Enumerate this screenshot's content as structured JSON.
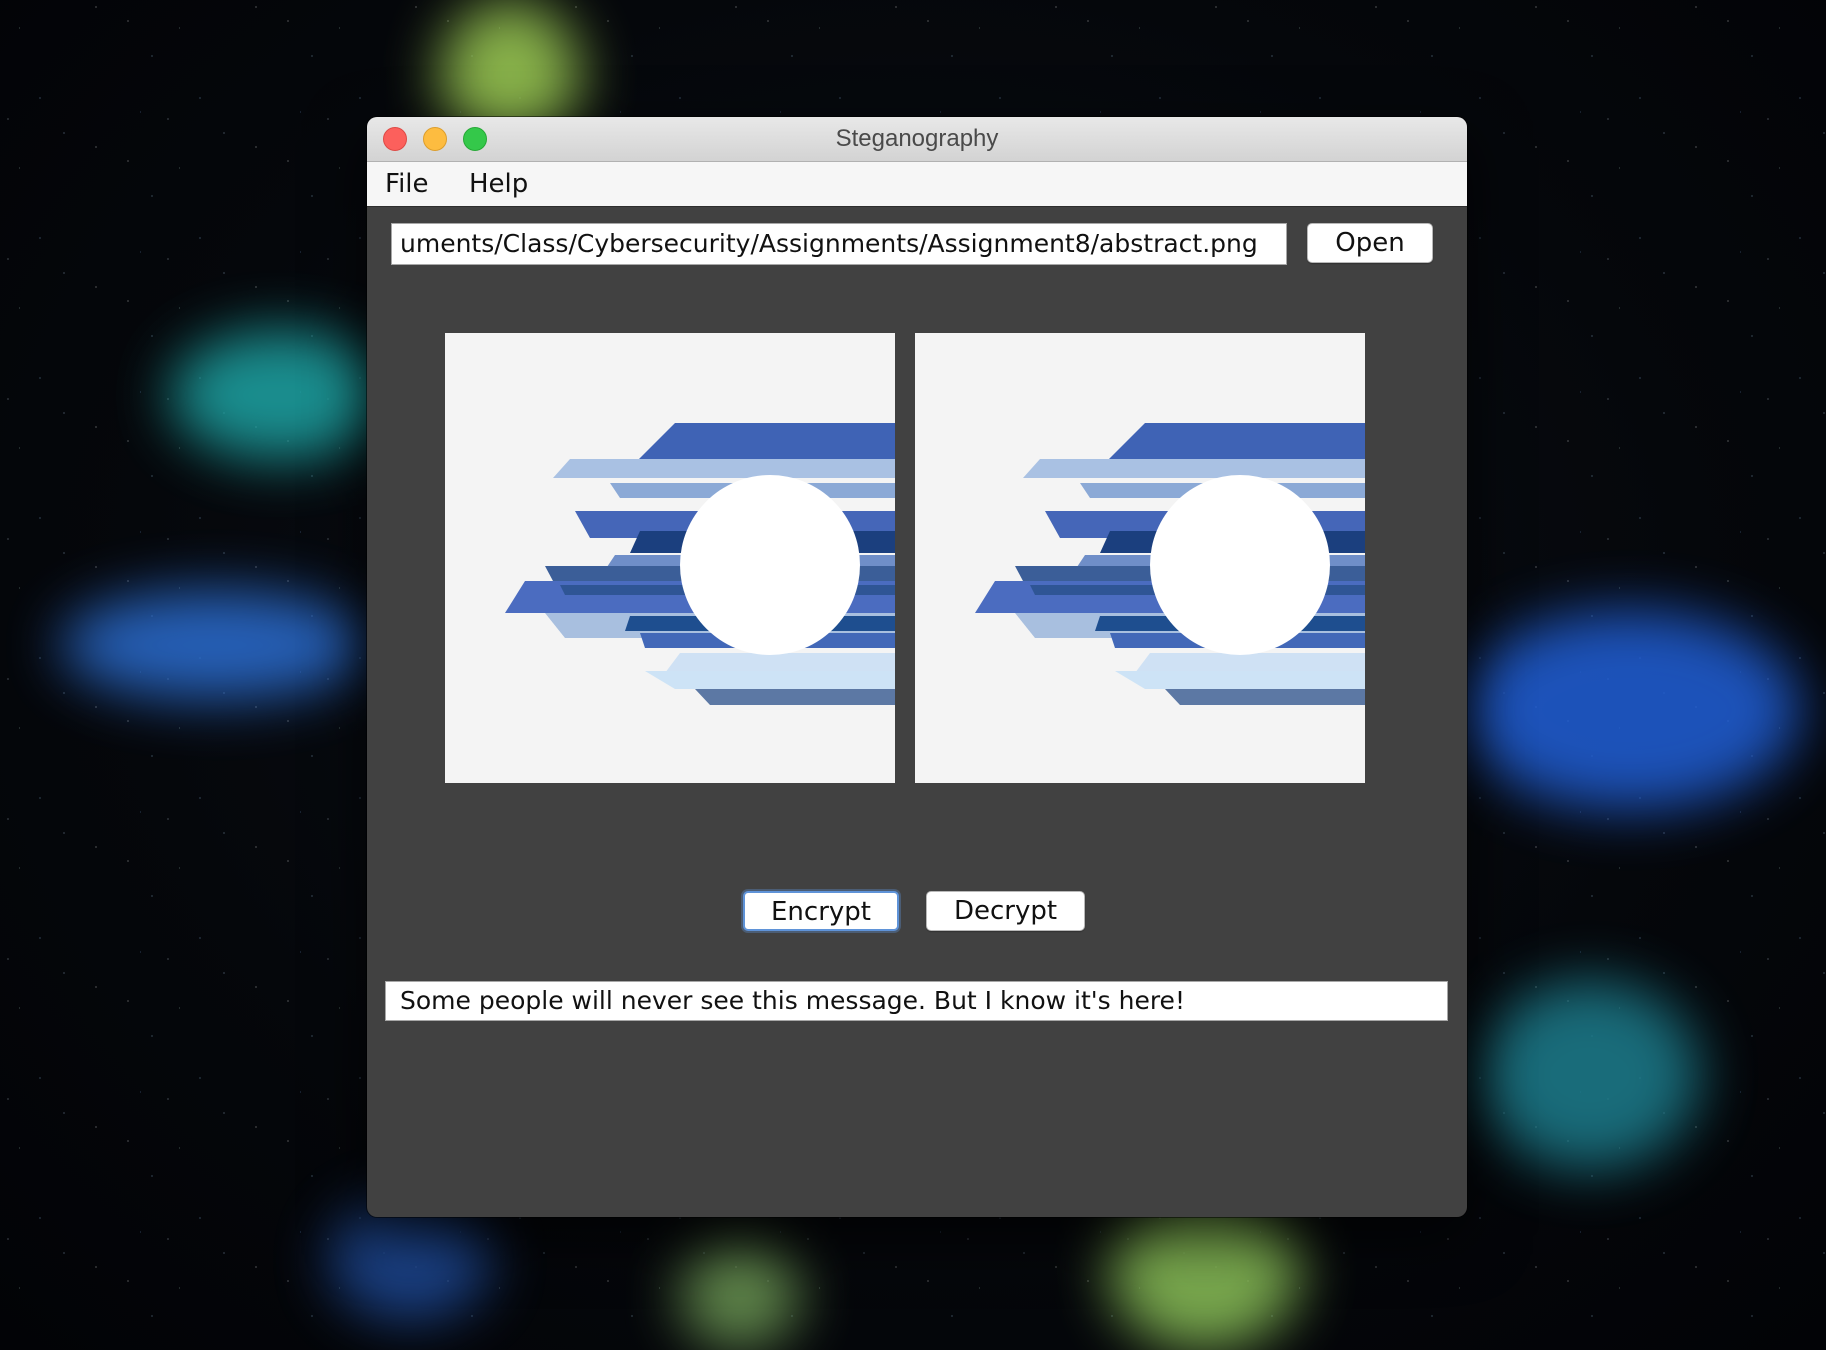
{
  "window": {
    "title": "Steganography"
  },
  "menubar": {
    "items": [
      {
        "label": "File"
      },
      {
        "label": "Help"
      }
    ]
  },
  "file_path": {
    "value": "uments/Class/Cybersecurity/Assignments/Assignment8/abstract.png",
    "open_label": "Open"
  },
  "images": {
    "original": {
      "icon": "abstract-blue-stripes-circle"
    },
    "encoded": {
      "icon": "abstract-blue-stripes-circle"
    }
  },
  "actions": {
    "encrypt_label": "Encrypt",
    "decrypt_label": "Decrypt"
  },
  "message": {
    "value": "Some people will never see this message. But I know it's here!"
  },
  "colors": {
    "window_bg": "#414141",
    "menubar_bg": "#f6f6f6",
    "focus_ring": "#5f93d8",
    "close": "#fc605c",
    "minimize": "#fdbc40",
    "maximize": "#34c84a"
  }
}
